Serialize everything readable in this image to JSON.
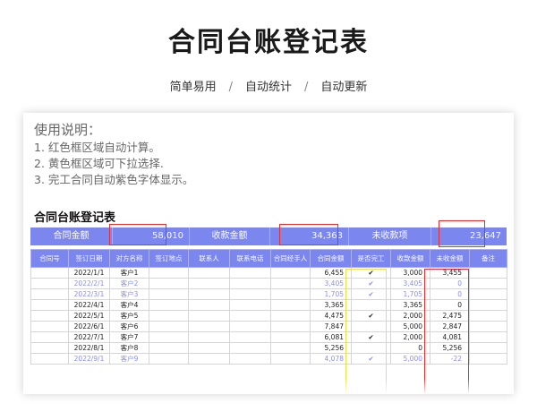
{
  "page": {
    "title": "合同台账登记表",
    "tagline": [
      "简单易用",
      "自动统计",
      "自动更新"
    ],
    "tagline_sep": "/"
  },
  "instructions": {
    "title": "使用说明：",
    "lines": [
      "1. 红色框区域自动计算。",
      "2. 黄色框区域可下拉选择.",
      "3. 完工合同自动紫色字体显示。"
    ]
  },
  "ledger": {
    "title": "合同台账登记表",
    "summary": {
      "contract_amount_label": "合同金额",
      "contract_amount_value": "58,010",
      "received_label": "收款金额",
      "received_value": "34,363",
      "unreceived_label": "未收款项",
      "unreceived_value": "23,647"
    },
    "columns": [
      "合同号",
      "签订日期",
      "对方名称",
      "签订地点",
      "联系人",
      "联系电话",
      "合同经手人",
      "合同金额",
      "是否完工",
      "收款金额",
      "未收金额",
      "备注"
    ],
    "rows": [
      {
        "date": "2022/1/1",
        "party": "客户1",
        "amount": "6,455",
        "done": "✔",
        "received": "3,000",
        "unreceived": "3,455",
        "completed": false
      },
      {
        "date": "2022/2/1",
        "party": "客户2",
        "amount": "3,405",
        "done": "✔",
        "received": "3,405",
        "unreceived": "0",
        "completed": true
      },
      {
        "date": "2022/3/1",
        "party": "客户3",
        "amount": "1,705",
        "done": "✔",
        "received": "1,705",
        "unreceived": "0",
        "completed": true
      },
      {
        "date": "2022/4/1",
        "party": "客户4",
        "amount": "3,365",
        "done": "",
        "received": "3,365",
        "unreceived": "0",
        "completed": false
      },
      {
        "date": "2022/5/1",
        "party": "客户5",
        "amount": "4,475",
        "done": "✔",
        "received": "2,000",
        "unreceived": "2,475",
        "completed": false
      },
      {
        "date": "2022/6/1",
        "party": "客户6",
        "amount": "7,847",
        "done": "",
        "received": "5,000",
        "unreceived": "2,847",
        "completed": false
      },
      {
        "date": "2022/7/1",
        "party": "客户7",
        "amount": "6,081",
        "done": "✔",
        "received": "2,000",
        "unreceived": "4,081",
        "completed": false
      },
      {
        "date": "2022/8/1",
        "party": "客户8",
        "amount": "5,256",
        "done": "",
        "received": "0",
        "unreceived": "5,256",
        "completed": false
      },
      {
        "date": "2022/9/1",
        "party": "客户9",
        "amount": "4,078",
        "done": "✔",
        "received": "5,000",
        "unreceived": "-22",
        "completed": true
      }
    ]
  },
  "colors": {
    "header_bg": "#7b86ee",
    "completed_text": "#8a8ef0",
    "auto_calc_box": "#e03030",
    "dropdown_box": "#f0e040"
  }
}
